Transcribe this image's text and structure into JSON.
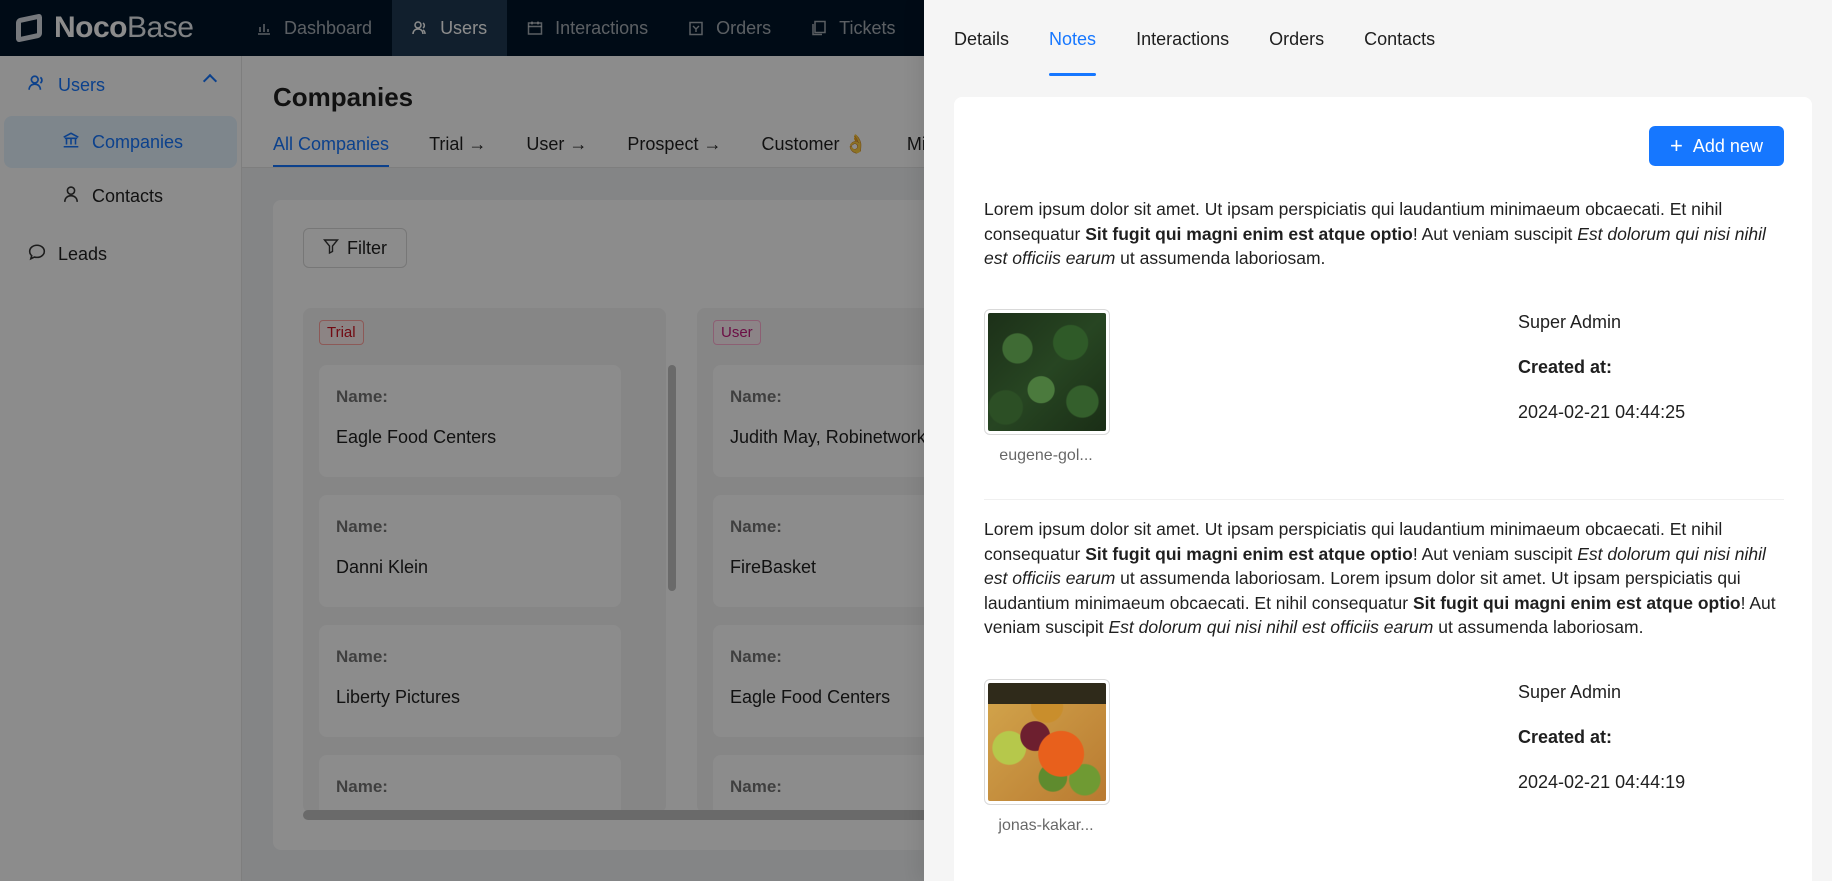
{
  "brand": {
    "logo_bold": "Noco",
    "logo_light": "Base"
  },
  "topnav": {
    "items": [
      {
        "label": "Dashboard"
      },
      {
        "label": "Users"
      },
      {
        "label": "Interactions"
      },
      {
        "label": "Orders"
      },
      {
        "label": "Tickets"
      }
    ]
  },
  "sidebar": {
    "group_label": "Users",
    "items": [
      {
        "label": "Companies"
      },
      {
        "label": "Contacts"
      }
    ],
    "leads_label": "Leads"
  },
  "page": {
    "title": "Companies",
    "tabs": [
      {
        "label": "All Companies"
      },
      {
        "label": "Trial →"
      },
      {
        "label": "User →"
      },
      {
        "label": "Prospect →"
      },
      {
        "label": "Customer 👌"
      },
      {
        "label": "Misma"
      }
    ],
    "filter_label": "Filter",
    "kanban": {
      "columns": [
        {
          "tag": "Trial",
          "cards": [
            {
              "label": "Name:",
              "value": "Eagle Food Centers"
            },
            {
              "label": "Name:",
              "value": "Danni Klein"
            },
            {
              "label": "Name:",
              "value": "Liberty Pictures"
            },
            {
              "label": "Name:",
              "value": ""
            }
          ]
        },
        {
          "tag": "User",
          "cards": [
            {
              "label": "Name:",
              "value": "Judith May, Robinetwork"
            },
            {
              "label": "Name:",
              "value": "FireBasket"
            },
            {
              "label": "Name:",
              "value": "Eagle Food Centers"
            },
            {
              "label": "Name:",
              "value": ""
            }
          ]
        }
      ]
    }
  },
  "drawer": {
    "tabs": [
      {
        "label": "Details"
      },
      {
        "label": "Notes"
      },
      {
        "label": "Interactions"
      },
      {
        "label": "Orders"
      },
      {
        "label": "Contacts"
      }
    ],
    "add_new_label": "Add new",
    "notes": [
      {
        "segments": [
          {
            "text": "Lorem ipsum dolor sit amet. Ut ipsam perspiciatis qui laudantium minimaeum obcaecati. Et nihil consequatur ",
            "style": "normal"
          },
          {
            "text": "Sit fugit qui magni enim est atque optio",
            "style": "bold"
          },
          {
            "text": "! Aut veniam suscipit ",
            "style": "normal"
          },
          {
            "text": "Est dolorum qui nisi nihil est officiis earum",
            "style": "italic"
          },
          {
            "text": " ut assumenda laboriosam.",
            "style": "normal"
          }
        ],
        "attachment_name": "eugene-gol...",
        "author": "Super Admin",
        "created_label": "Created at:",
        "created_at": "2024-02-21 04:44:25"
      },
      {
        "segments": [
          {
            "text": "Lorem ipsum dolor sit amet. Ut ipsam perspiciatis qui laudantium minimaeum obcaecati. Et nihil consequatur ",
            "style": "normal"
          },
          {
            "text": "Sit fugit qui magni enim est atque optio",
            "style": "bold"
          },
          {
            "text": "! Aut veniam suscipit ",
            "style": "normal"
          },
          {
            "text": "Est dolorum qui nisi nihil est officiis earum",
            "style": "italic"
          },
          {
            "text": " ut assumenda laboriosam. Lorem ipsum dolor sit amet. Ut ipsam perspiciatis qui laudantium minimaeum obcaecati. Et nihil consequatur ",
            "style": "normal"
          },
          {
            "text": "Sit fugit qui magni enim est atque optio",
            "style": "bold"
          },
          {
            "text": "! Aut veniam suscipit ",
            "style": "normal"
          },
          {
            "text": "Est dolorum qui nisi nihil est officiis earum",
            "style": "italic"
          },
          {
            "text": " ut assumenda laboriosam.",
            "style": "normal"
          }
        ],
        "attachment_name": "jonas-kakar...",
        "author": "Super Admin",
        "created_label": "Created at:",
        "created_at": "2024-02-21 04:44:19"
      }
    ]
  },
  "colors": {
    "primary": "#1677ff",
    "topbar_bg": "#001529",
    "trial_tag": "#cf1322",
    "user_tag": "#c41d7f"
  }
}
